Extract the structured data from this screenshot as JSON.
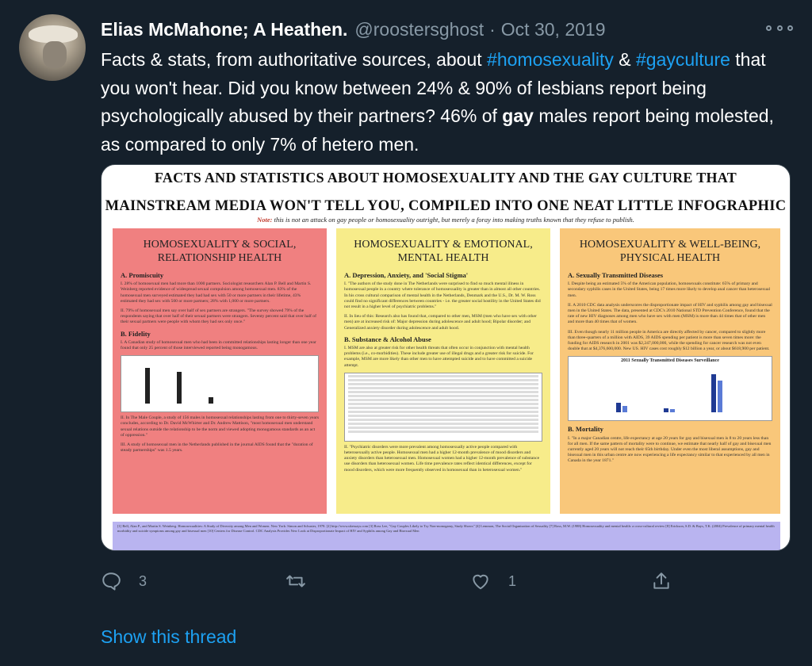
{
  "tweet": {
    "author_name": "Elias McMahone; A Heathen.",
    "handle": "@roostersghost",
    "separator": "·",
    "date": "Oct 30, 2019",
    "text_parts": {
      "p1": "Facts & stats, from authoritative sources, about ",
      "hashtag1": "#homosexuality",
      "p2": " & ",
      "hashtag2": "#gayculture",
      "p3": " that you won't hear.  Did you know between 24% & 90% of lesbians report being psychologically abused by their partners? 46% of ",
      "bold": "gay",
      "p4": " males report being molested, as compared to only 7% of hetero men."
    }
  },
  "infographic": {
    "title_line1": "FACTS AND STATISTICS ABOUT HOMOSEXUALITY AND THE GAY CULTURE THAT",
    "title_line2": "MAINSTREAM MEDIA WON'T TELL YOU, COMPILED INTO ONE NEAT LITTLE INFOGRAPHIC",
    "note_label": "Note:",
    "note_text": " this is not an attack on gay people or homosexuality outright, but merely a foray into making truths known that they refuse to publish.",
    "columns": [
      {
        "heading": "HOMOSEXUALITY & SOCIAL, RELATIONSHIP HEALTH",
        "sec1": "A. Promiscuity",
        "p1": "I. 28% of homosexual men had more than 1000 partners. Sociologist researchers Alan P. Bell and Martin S. Weinberg reported evidence of widespread sexual compulsion among homosexual men. 83% of the homosexual men surveyed estimated they had had sex with 50 or more partners in their lifetime, 43% estimated they had sex with 500 or more partners; 28% with 1,000 or more partners.",
        "p2": "II. 79% of homosexual men say over half of sex partners are strangers. \"The survey showed 79% of the respondents saying that over half of their sexual partners were strangers. Seventy percent said that over half of their sexual partners were people with whom they had sex only once.\"",
        "sec2": "B. Fidelity",
        "p3": "I. A Canadian study of homosexual men who had been in committed relationships lasting longer than one year found that only 25 percent of those interviewed reported being monogamous.",
        "p4": "II. In The Male Couple, a study of 156 males in homosexual relationships lasting from one to thirty-seven years concludes, according to Dr. David McWhirter and Dr. Andrew Mattison, \"most homosexual men understand sexual relations outside the relationship to be the norm and viewed adopting monogamous standards as an act of oppression.\"",
        "p5": "III. A study of homosexual men in the Netherlands published in the journal AIDS found that the \"duration of steady partnerships\" was 1.5 years."
      },
      {
        "heading": "HOMOSEXUALITY & EMOTIONAL, MENTAL HEALTH",
        "sec1": "A. Depression, Anxiety, and 'Social Stigma'",
        "p1": "I. \"The authors of the study done in The Netherlands were surprised to find so much mental illness in homosexual people in a country where tolerance of homosexuality is greater than in almost all other countries. In his cross cultural comparison of mental health in the Netherlands, Denmark and the U.S., Dr. M. W. Ross could find no significant differences between countries - i.e. the greater social hostility in the United States did not result in a higher level of psychiatric problems.\"",
        "p2": "II. In lieu of this: Research also has found that, compared to other men, MSM (men who have sex with other men) are at increased risk of: Major depression during adolescence and adult hood; Bipolar disorder; and Generalized anxiety disorder during adolescence and adult hood.",
        "sec2": "B. Substance & Alcohol Abuse",
        "p3": "I. MSM are also at greater risk for other health threats that often occur in conjunction with mental health problems (i.e., co-morbidities). These include greater use of illegal drugs and a greater risk for suicide. For example, MSM are more likely than other men to have attempted suicide and to have committed a suicide attempt.",
        "p4": "II. \"Psychiatric disorders were more prevalent among homosexually active people compared with heterosexually active people. Homosexual men had a higher 12-month prevalence of mood disorders and anxiety disorders than heterosexual men. Homosexual women had a higher 12-month prevalence of substance use disorders than heterosexual women. Life time prevalence rates reflect identical differences, except for mood disorders, which were more frequently observed in homosexual than in heterosexual women.\""
      },
      {
        "heading": "HOMOSEXUALITY & WELL-BEING, PHYSICAL HEALTH",
        "sec1": "A. Sexually Transmitted Diseases",
        "p1": "I. Despite being an estimated 5% of the American population, homosexuals constitute: 65% of primary and secondary syphilis cases in the United States, being 17 times more likely to develop anal cancer than heterosexual men.",
        "p2": "II. A 2010 CDC data analysis underscores the disproportionate impact of HIV and syphilis among gay and bisexual men in the United States. The data, presented at CDC's 2010 National STD Prevention Conference, found that the rate of new HIV diagnoses among men who have sex with men (MSM) is more than 44 times that of other men and more than 40 times that of women.",
        "p3": "III. Even though nearly 11 million people in America are directly affected by cancer, compared to slightly more than three-quarters of a million with AIDS, 39 AIDS spending per patient is more than seven times more: the funding for AIDS research in 2001 was $2,247,000,000, while the spending for cancer research was not even double that at $4,376,600,000. New US. HIV cases cost roughly $12 billion a year, or about $618,900 per patient.",
        "chart_title": "2011 Sexually Transmitted Diseases Surveillance",
        "sec2": "B. Mortality",
        "p4": "I. \"In a major Canadian centre, life expectancy at age 20 years for gay and bisexual men is 8 to 20 years less than for all men. If the same pattern of mortality were to continue, we estimate that nearly half of gay and bisexual men currently aged 20 years will not reach their 65th birthday. Under even the most liberal assumptions, gay and bisexual men in this urban centre are now experiencing a life expectancy similar to that experienced by all men in Canada in the year 1871.\""
      }
    ],
    "references": "[1] Bell, Alan P., and Martin S. Weinberg. Homosexualities: A Study of Diversity among Men and Women. New York: Simon and Schuster, 1978. [2] http://www.ukessays.com  [3] Ross Lee, \"Gay Couples Likely to Try Non-monogamy, Study Shows\" [4] Lemmon, The Social Organization of Sexuality [7] Ross, M.W. (1988) Homosexuality and mental health: a cross-cultural review [8] Erickson, S.D. & Bays, T.K. (2004) Prevalence of primary mental health morbidity and suicide symptoms among gay and bisexual men [10] Centers for Disease Control. CDC Analysis Provides New Look at Disproportionate Impact of HIV and Syphilis among Gay and Bisexual Men"
  },
  "actions": {
    "reply_count": "3",
    "retweet_count": "",
    "like_count": "1"
  },
  "show_thread": "Show this thread"
}
